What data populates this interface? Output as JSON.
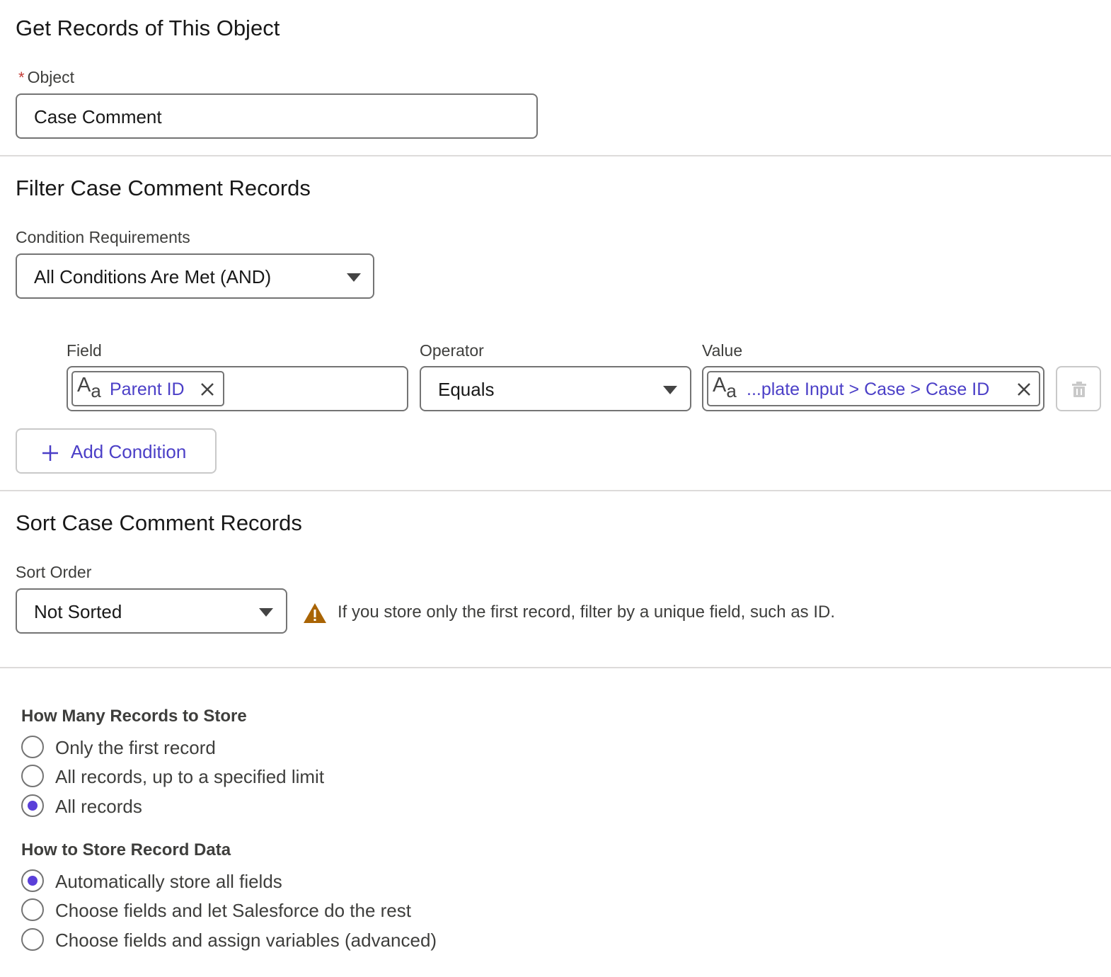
{
  "object_section": {
    "title": "Get Records of This Object",
    "required_marker": "*",
    "object_label": "Object",
    "object_value": "Case Comment"
  },
  "filter_section": {
    "title": "Filter Case Comment Records",
    "condition_requirements_label": "Condition Requirements",
    "condition_requirements_value": "All Conditions Are Met (AND)",
    "field_label": "Field",
    "operator_label": "Operator",
    "value_label": "Value",
    "condition": {
      "field_pill": "Parent ID",
      "operator": "Equals",
      "value_pill": "...plate Input > Case > Case ID"
    },
    "add_condition_label": "Add Condition"
  },
  "sort_section": {
    "title": "Sort Case Comment Records",
    "sort_order_label": "Sort Order",
    "sort_order_value": "Not Sorted",
    "warning_text": "If you store only the first record, filter by a unique field, such as ID."
  },
  "how_many": {
    "title": "How Many Records to Store",
    "options": [
      {
        "label": "Only the first record",
        "checked": false
      },
      {
        "label": "All records, up to a specified limit",
        "checked": false
      },
      {
        "label": "All records",
        "checked": true
      }
    ]
  },
  "how_to_store": {
    "title": "How to Store Record Data",
    "options": [
      {
        "label": "Automatically store all fields",
        "checked": true
      },
      {
        "label": "Choose fields and let Salesforce do the rest",
        "checked": false
      },
      {
        "label": "Choose fields and assign variables (advanced)",
        "checked": false
      }
    ]
  },
  "colors": {
    "accent": "#5a3fd9",
    "link": "#4b3fc7",
    "required": "#c23934",
    "warning": "#a96404",
    "border": "#747474"
  },
  "icons": {
    "text_type": "text-type-icon",
    "remove": "close-icon",
    "dropdown": "chevron-down-icon",
    "delete": "trash-icon",
    "add": "plus-icon",
    "warning": "warning-icon"
  }
}
